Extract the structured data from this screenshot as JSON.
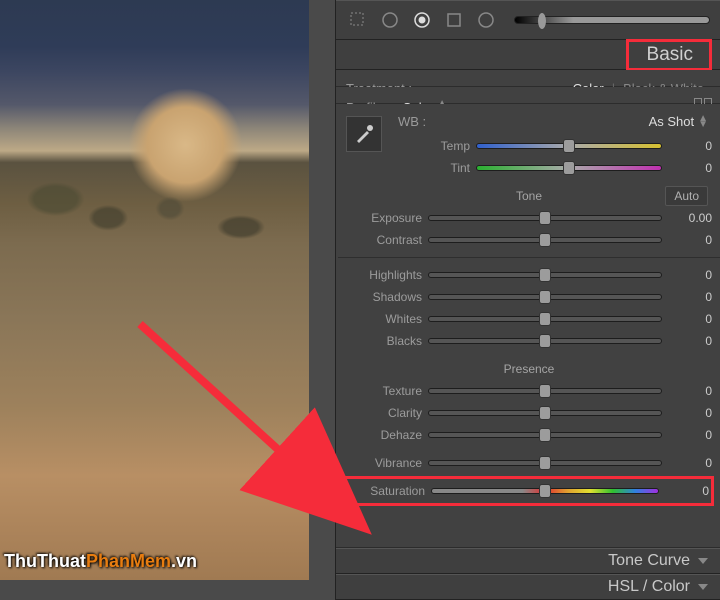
{
  "watermark": "ThuThuatPhanMem.vn",
  "panel": {
    "basic": "Basic"
  },
  "treatment": {
    "label": "Treatment :",
    "color": "Color",
    "bw": "Black & White"
  },
  "profile": {
    "label": "Profile :",
    "value": "Color"
  },
  "wb": {
    "label": "WB :",
    "value": "As Shot"
  },
  "sliders": {
    "temp": {
      "label": "Temp",
      "value": "0",
      "pos": 50,
      "track": "track-temp"
    },
    "tint": {
      "label": "Tint",
      "value": "0",
      "pos": 50,
      "track": "track-tint"
    },
    "exposure": {
      "label": "Exposure",
      "value": "0.00",
      "pos": 50,
      "track": "track-gray"
    },
    "contrast": {
      "label": "Contrast",
      "value": "0",
      "pos": 50,
      "track": "track-gray"
    },
    "highlights": {
      "label": "Highlights",
      "value": "0",
      "pos": 50,
      "track": "track-gray"
    },
    "shadows": {
      "label": "Shadows",
      "value": "0",
      "pos": 50,
      "track": "track-gray"
    },
    "whites": {
      "label": "Whites",
      "value": "0",
      "pos": 50,
      "track": "track-gray"
    },
    "blacks": {
      "label": "Blacks",
      "value": "0",
      "pos": 50,
      "track": "track-gray"
    },
    "texture": {
      "label": "Texture",
      "value": "0",
      "pos": 50,
      "track": "track-gray"
    },
    "clarity": {
      "label": "Clarity",
      "value": "0",
      "pos": 50,
      "track": "track-gray"
    },
    "dehaze": {
      "label": "Dehaze",
      "value": "0",
      "pos": 50,
      "track": "track-gray"
    },
    "vibrance": {
      "label": "Vibrance",
      "value": "0",
      "pos": 50,
      "track": "track-gray"
    },
    "saturation": {
      "label": "Saturation",
      "value": "0",
      "pos": 50,
      "track": "track-sat"
    }
  },
  "headings": {
    "tone": "Tone",
    "presence": "Presence",
    "auto": "Auto"
  },
  "collapsed": {
    "toneCurve": "Tone Curve",
    "hsl": "HSL / Color"
  }
}
